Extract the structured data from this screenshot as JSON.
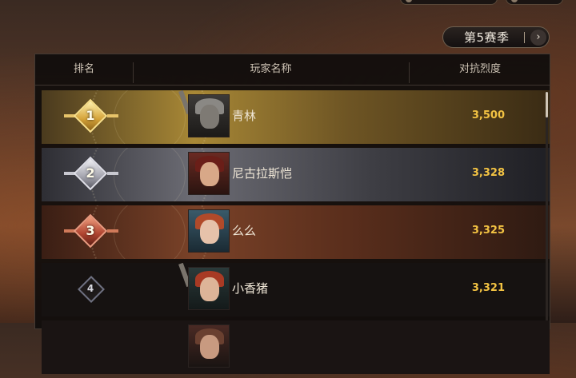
{
  "season": {
    "label": "第5赛季"
  },
  "table": {
    "headers": {
      "rank": "排名",
      "name": "玩家名称",
      "score": "对抗烈度"
    },
    "rows": [
      {
        "rank": "1",
        "name": "青林",
        "score": "3,500",
        "tier": "gold"
      },
      {
        "rank": "2",
        "name": "尼古拉斯恺",
        "score": "3,328",
        "tier": "silver"
      },
      {
        "rank": "3",
        "name": "么么",
        "score": "3,325",
        "tier": "bronze"
      },
      {
        "rank": "4",
        "name": "小香猪",
        "score": "3,321",
        "tier": "normal"
      },
      {
        "rank": "",
        "name": "",
        "score": "",
        "tier": "normal"
      }
    ]
  },
  "colors": {
    "score": "#f3c343",
    "gold": "#d6a43a",
    "silver": "#a6a6b0",
    "bronze": "#b04430"
  },
  "icons": {
    "season_arrow": "chevron-right-icon"
  }
}
